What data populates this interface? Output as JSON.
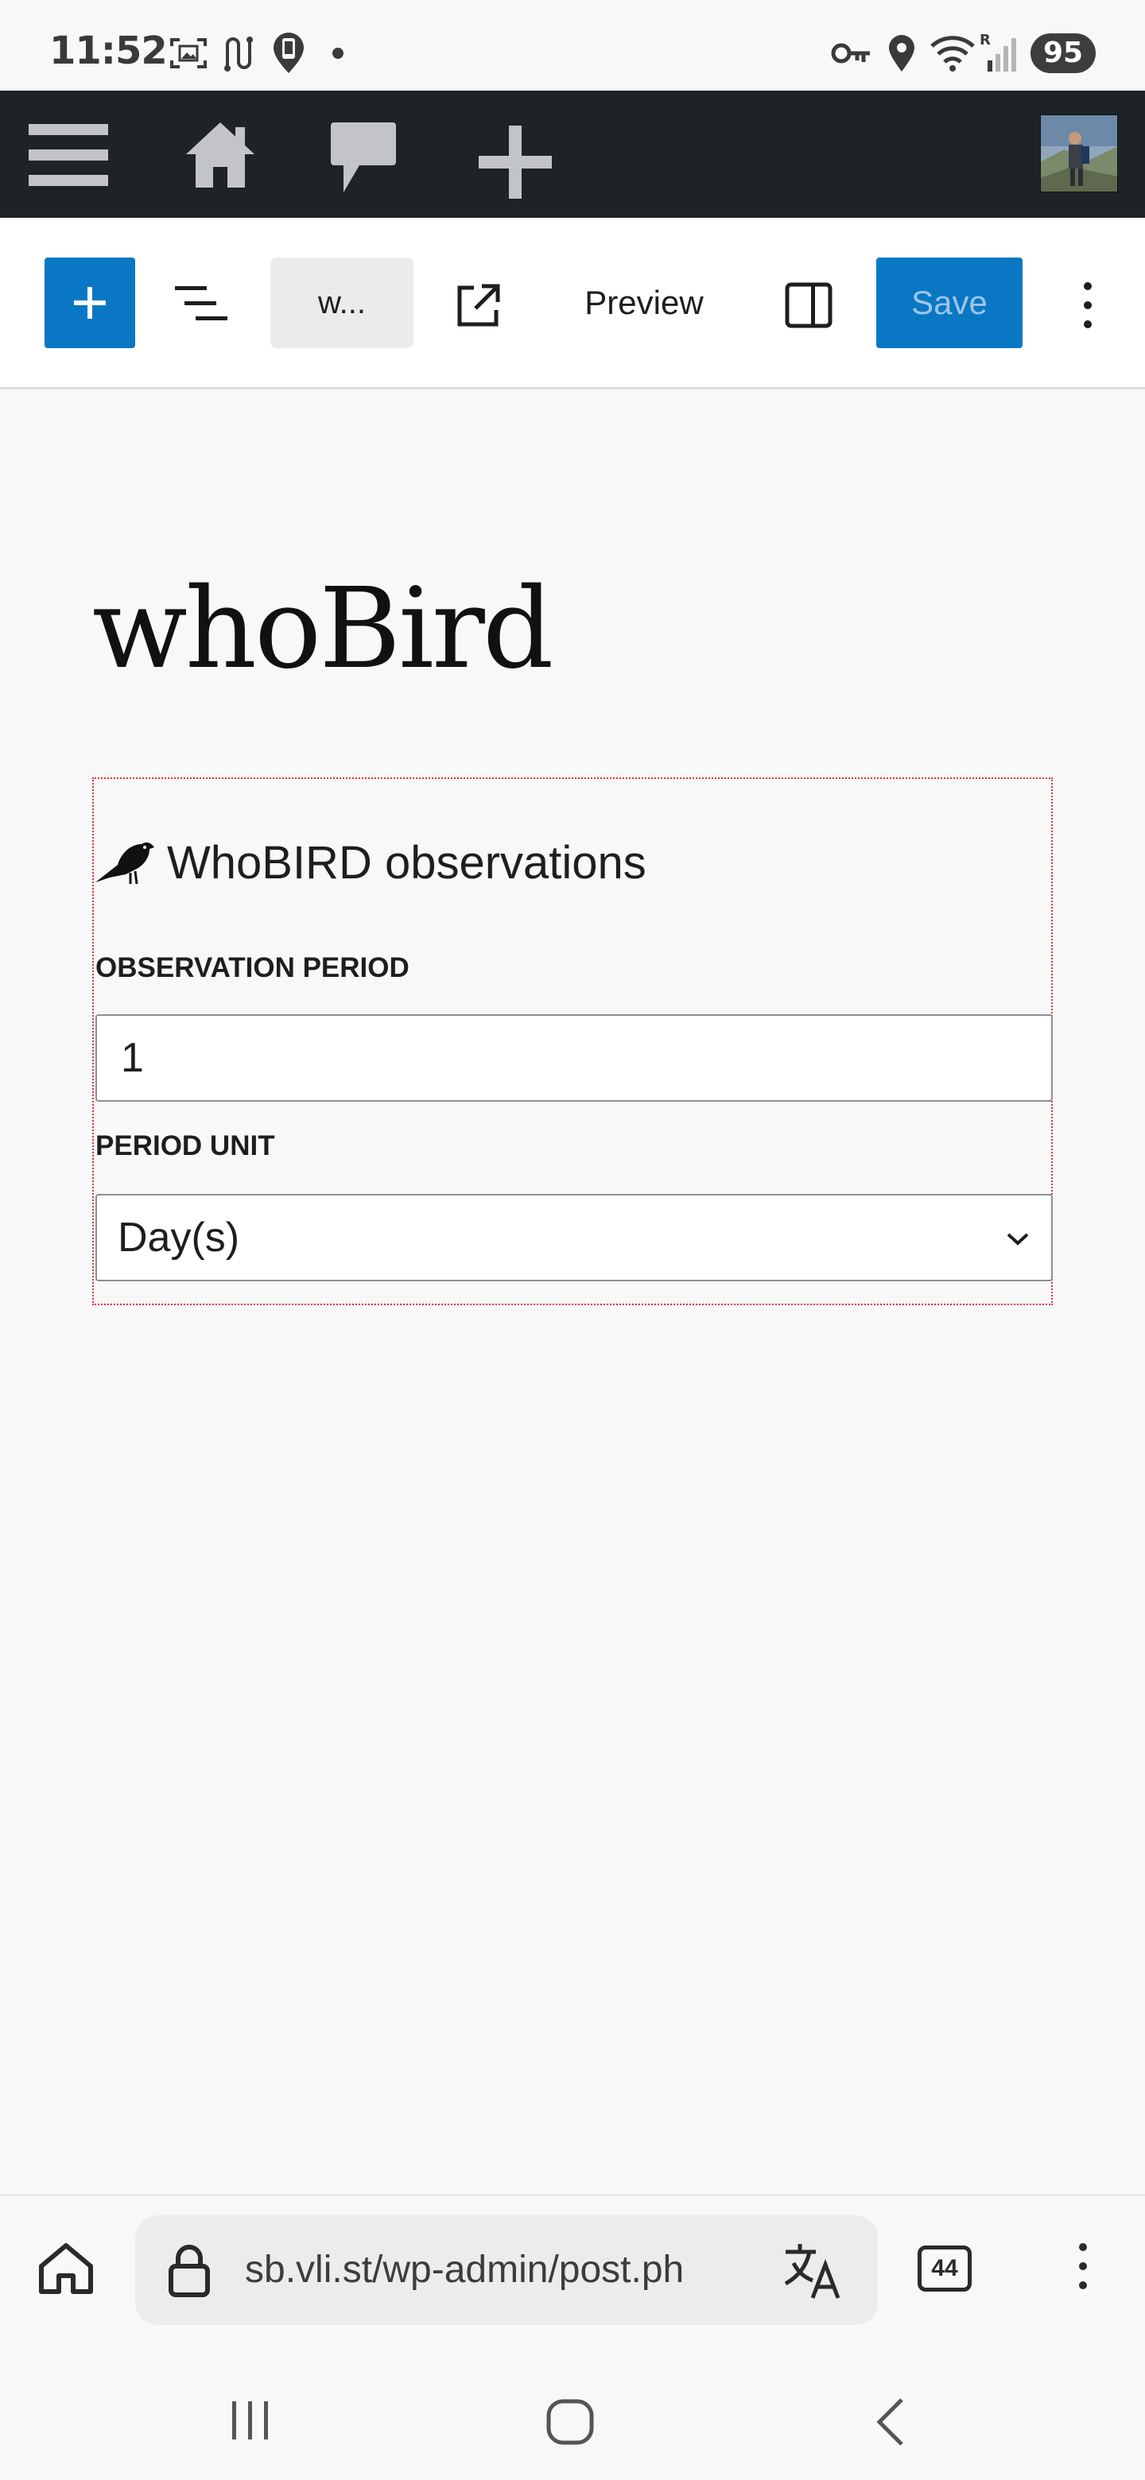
{
  "status_bar": {
    "time": "11:52",
    "battery": "95",
    "icons": [
      "screenshot-icon",
      "route-icon",
      "phone-location-icon",
      "dot-icon",
      "key-icon",
      "location-pin-icon",
      "wifi-icon",
      "signal-icon"
    ]
  },
  "admin_bar": {
    "icons": [
      "menu-icon",
      "home-icon",
      "comment-icon",
      "plus-icon",
      "avatar"
    ]
  },
  "toolbar": {
    "document_label": "w...",
    "preview_label": "Preview",
    "save_label": "Save",
    "accent_color": "#0a77c4"
  },
  "post": {
    "title": "whoBird",
    "block": {
      "heading": "WhoBIRD observations",
      "icon": "bird-icon",
      "observation_period_label": "OBSERVATION PERIOD",
      "observation_period_value": "1",
      "period_unit_label": "PERIOD UNIT",
      "period_unit_value": "Day(s)"
    }
  },
  "browser": {
    "url": "sb.vli.st/wp-admin/post.ph",
    "tab_count": "44"
  }
}
